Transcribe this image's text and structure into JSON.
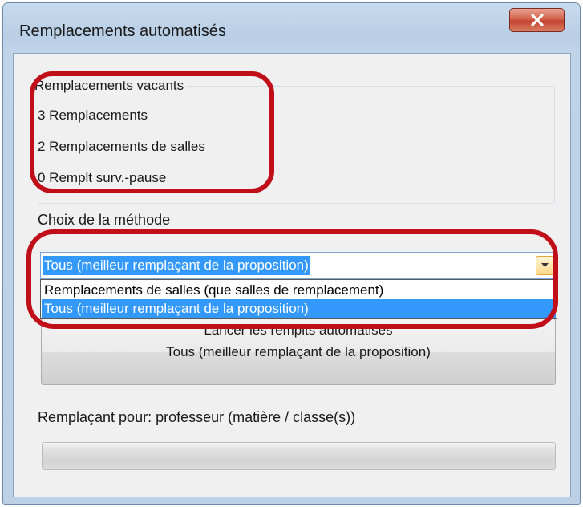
{
  "window": {
    "title": "Remplacements automatisés",
    "close_glyph": "x"
  },
  "vacant": {
    "legend": "Remplacements vacants",
    "items": [
      "3 Remplacements",
      "2 Remplacements de salles",
      "0 Remplt surv.-pause"
    ]
  },
  "method": {
    "label": "Choix de la méthode",
    "selected": "Tous (meilleur remplaçant de la proposition)",
    "options": [
      "Remplacements de salles (que salles de remplacement)",
      "Tous (meilleur remplaçant de la proposition)"
    ],
    "highlighted_index": 1
  },
  "launch": {
    "line1": "Lancer les rempits automatisés",
    "line2": "Tous (meilleur remplaçant de la proposition)"
  },
  "replacing": {
    "label": "Remplaçant pour: professeur (matière / classe(s))"
  },
  "progress": {
    "value_percent": 0
  },
  "colors": {
    "annotation": "#c10f1a",
    "selection": "#3399ff"
  }
}
